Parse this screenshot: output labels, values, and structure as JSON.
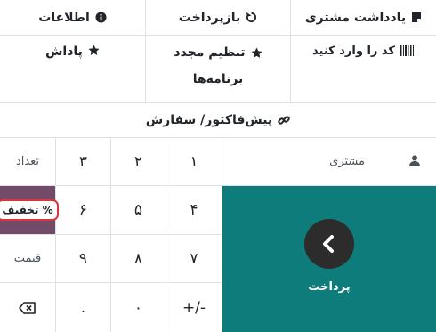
{
  "controls": {
    "customer_note": {
      "label": "یادداشت مشتری",
      "icon": "note-icon"
    },
    "refund": {
      "label": "بازپرداخت",
      "icon": "undo-icon"
    },
    "info": {
      "label": "اطلاعات",
      "icon": "info-icon"
    },
    "enter_code": {
      "label": "کد را وارد کنید",
      "icon": "barcode-icon"
    },
    "reset_programs": {
      "line1": "تنظیم مجدد",
      "line2": "برنامه‌ها",
      "icon": "star-icon"
    },
    "reward": {
      "label": "پاداش",
      "icon": "star-icon"
    },
    "quotation": {
      "label": "پیش‌فاکتور/ سفارش",
      "icon": "link-icon"
    }
  },
  "customer": {
    "label": "مشتری",
    "icon": "user-icon"
  },
  "payment": {
    "label": "پرداخت",
    "icon": "chevron-left-icon"
  },
  "numpad": {
    "k1": "۱",
    "k2": "۲",
    "k3": "۳",
    "qty": "تعداد",
    "k4": "۴",
    "k5": "۵",
    "k6": "۶",
    "disc": "% تخفیف",
    "k7": "۷",
    "k8": "۸",
    "k9": "۹",
    "price": "قیمت",
    "sign": "+/-",
    "k0": "۰",
    "dot": ".",
    "backspace_icon": "backspace-icon"
  },
  "colors": {
    "payment_bg": "#0e7c7b",
    "active_mode_bg": "#714b67",
    "highlight_border": "#d9363e"
  }
}
